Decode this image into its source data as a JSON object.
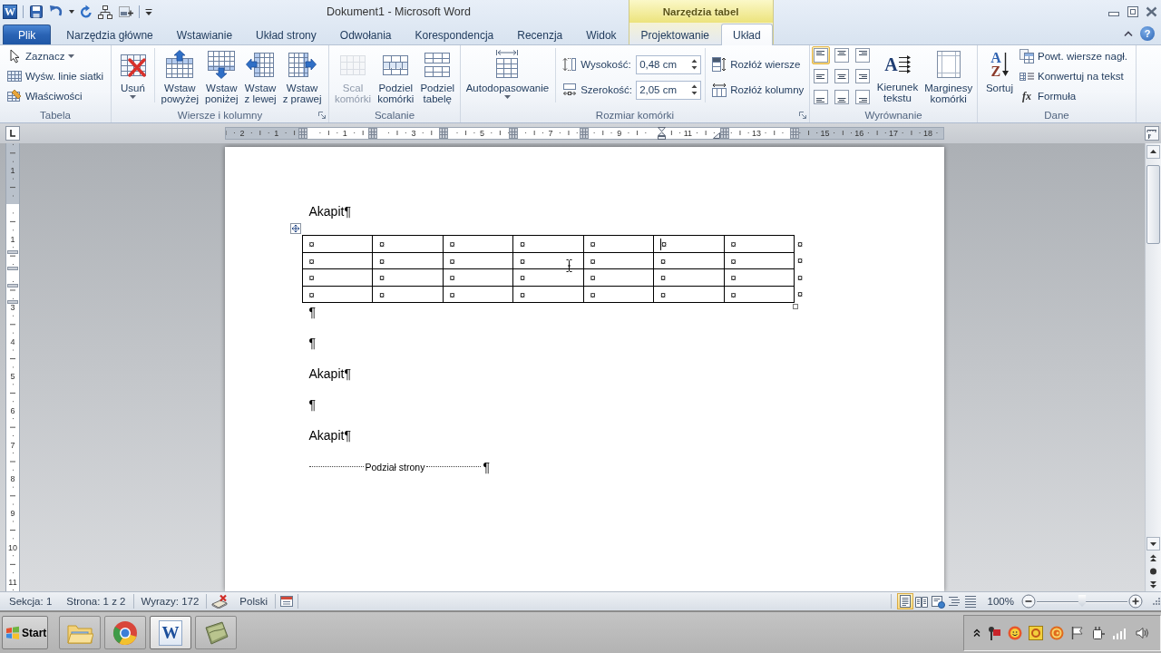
{
  "title_bar": {
    "app_icon_glyph": "W",
    "title": "Dokument1 - Microsoft Word",
    "context_header": "Narzędzia tabel",
    "help_glyph": "?"
  },
  "tabs": [
    {
      "label": "Plik",
      "kind": "file",
      "selected": false
    },
    {
      "label": "Narzędzia główne",
      "kind": "normal",
      "selected": false
    },
    {
      "label": "Wstawianie",
      "kind": "normal",
      "selected": false
    },
    {
      "label": "Układ strony",
      "kind": "normal",
      "selected": false
    },
    {
      "label": "Odwołania",
      "kind": "normal",
      "selected": false
    },
    {
      "label": "Korespondencja",
      "kind": "normal",
      "selected": false
    },
    {
      "label": "Recenzja",
      "kind": "normal",
      "selected": false
    },
    {
      "label": "Widok",
      "kind": "normal",
      "selected": false
    },
    {
      "label": "Projektowanie",
      "kind": "contextual",
      "selected": false
    },
    {
      "label": "Układ",
      "kind": "contextual",
      "selected": true
    }
  ],
  "ribbon": {
    "groups": [
      {
        "label": "Tabela",
        "launcher": false,
        "sections": [
          [
            {
              "kind": "stack",
              "items": [
                {
                  "label": "Zaznacz",
                  "dropdown": true,
                  "disabled": false
                },
                {
                  "label": "Wyśw. linie siatki",
                  "dropdown": false,
                  "disabled": false
                },
                {
                  "label": "Właściwości",
                  "dropdown": false,
                  "disabled": false
                }
              ]
            }
          ]
        ]
      },
      {
        "label": "Wiersze i kolumny",
        "launcher": true,
        "sections": [
          [
            {
              "kind": "large",
              "lines": [
                "Usuń"
              ],
              "dropdown": true,
              "disabled": false
            }
          ],
          [
            {
              "kind": "large",
              "lines": [
                "Wstaw",
                "powyżej"
              ],
              "dropdown": false,
              "disabled": false
            },
            {
              "kind": "large",
              "lines": [
                "Wstaw",
                "poniżej"
              ],
              "dropdown": false,
              "disabled": false
            },
            {
              "kind": "large",
              "lines": [
                "Wstaw",
                "z lewej"
              ],
              "dropdown": false,
              "disabled": false
            },
            {
              "kind": "large",
              "lines": [
                "Wstaw",
                "z prawej"
              ],
              "dropdown": false,
              "disabled": false
            }
          ]
        ]
      },
      {
        "label": "Scalanie",
        "launcher": false,
        "sections": [
          [
            {
              "kind": "large",
              "lines": [
                "Scal",
                "komórki"
              ],
              "dropdown": false,
              "disabled": true
            },
            {
              "kind": "large",
              "lines": [
                "Podziel",
                "komórki"
              ],
              "dropdown": false,
              "disabled": false
            },
            {
              "kind": "large",
              "lines": [
                "Podziel",
                "tabelę"
              ],
              "dropdown": false,
              "disabled": false
            }
          ]
        ]
      },
      {
        "label": "Rozmiar komórki",
        "launcher": true,
        "sections": [
          [
            {
              "kind": "large",
              "lines": [
                "Autodopasowanie"
              ],
              "dropdown": true,
              "disabled": false
            }
          ],
          [
            {
              "kind": "spins",
              "items": [
                {
                  "label": "Wysokość:",
                  "value": "0,48 cm"
                },
                {
                  "label": "Szerokość:",
                  "value": "2,05 cm"
                }
              ]
            }
          ],
          [
            {
              "kind": "stack",
              "items": [
                {
                  "label": "Rozłóż wiersze",
                  "dropdown": false,
                  "disabled": false
                },
                {
                  "label": "Rozłóż kolumny",
                  "dropdown": false,
                  "disabled": false
                }
              ]
            }
          ]
        ]
      },
      {
        "label": "Wyrównanie",
        "launcher": false,
        "sections": [
          [
            {
              "kind": "align_grid",
              "buttons": [
                {
                  "selected": true
                },
                {
                  "selected": false
                },
                {
                  "selected": false
                },
                {
                  "selected": false
                },
                {
                  "selected": false
                },
                {
                  "selected": false
                },
                {
                  "selected": false
                },
                {
                  "selected": false
                },
                {
                  "selected": false
                }
              ]
            },
            {
              "kind": "large",
              "lines": [
                "Kierunek",
                "tekstu"
              ],
              "glyphs": [
                "A"
              ],
              "dropdown": false,
              "disabled": false
            },
            {
              "kind": "large",
              "lines": [
                "Marginesy",
                "komórki"
              ],
              "dropdown": false,
              "disabled": false
            }
          ]
        ]
      },
      {
        "label": "Dane",
        "launcher": false,
        "sections": [
          [
            {
              "kind": "large",
              "lines": [
                "Sortuj"
              ],
              "glyphs": [
                "A",
                "Z"
              ],
              "dropdown": false,
              "disabled": false
            },
            {
              "kind": "stack",
              "items": [
                {
                  "label": "Powt. wiersze nagł.",
                  "dropdown": false,
                  "disabled": false
                },
                {
                  "label": "Konwertuj na tekst",
                  "dropdown": false,
                  "disabled": false
                },
                {
                  "label": "Formuła",
                  "glyph": "fx",
                  "dropdown": false,
                  "disabled": false
                }
              ]
            }
          ]
        ]
      }
    ]
  },
  "rulers": {
    "horizontal": [
      "2",
      "1",
      "1",
      "3",
      "5",
      "7",
      "9",
      "11",
      "13",
      "15",
      "16",
      "17",
      "18"
    ],
    "vertical": [
      "1",
      "1",
      "3",
      "4",
      "5",
      "6",
      "7",
      "8",
      "9",
      "10",
      "11"
    ]
  },
  "document": {
    "blocks": [
      {
        "kind": "paragraph",
        "text": "Akapit¶"
      },
      {
        "kind": "table",
        "rows": [
          {
            "cells": [
              {
                "text": "¤",
                "caret": false
              },
              {
                "text": "¤",
                "caret": false
              },
              {
                "text": "¤",
                "caret": false
              },
              {
                "text": "¤",
                "caret": false
              },
              {
                "text": "¤",
                "caret": false
              },
              {
                "text": "¤",
                "caret": true
              },
              {
                "text": "¤",
                "caret": false
              }
            ],
            "end_mark": "¤"
          },
          {
            "cells": [
              {
                "text": "¤",
                "caret": false
              },
              {
                "text": "¤",
                "caret": false
              },
              {
                "text": "¤",
                "caret": false
              },
              {
                "text": "¤",
                "caret": false
              },
              {
                "text": "¤",
                "caret": false
              },
              {
                "text": "¤",
                "caret": false
              },
              {
                "text": "¤",
                "caret": false
              }
            ],
            "end_mark": "¤"
          },
          {
            "cells": [
              {
                "text": "¤",
                "caret": false
              },
              {
                "text": "¤",
                "caret": false
              },
              {
                "text": "¤",
                "caret": false
              },
              {
                "text": "¤",
                "caret": false
              },
              {
                "text": "¤",
                "caret": false
              },
              {
                "text": "¤",
                "caret": false
              },
              {
                "text": "¤",
                "caret": false
              }
            ],
            "end_mark": "¤"
          },
          {
            "cells": [
              {
                "text": "¤",
                "caret": false
              },
              {
                "text": "¤",
                "caret": false
              },
              {
                "text": "¤",
                "caret": false
              },
              {
                "text": "¤",
                "caret": false
              },
              {
                "text": "¤",
                "caret": false
              },
              {
                "text": "¤",
                "caret": false
              },
              {
                "text": "¤",
                "caret": false
              }
            ],
            "end_mark": "¤"
          }
        ]
      },
      {
        "kind": "paragraph",
        "text": "¶"
      },
      {
        "kind": "paragraph",
        "text": "¶"
      },
      {
        "kind": "paragraph",
        "text": "Akapit¶"
      },
      {
        "kind": "paragraph",
        "text": "¶"
      },
      {
        "kind": "paragraph",
        "text": "Akapit¶"
      },
      {
        "kind": "page_break",
        "label": "Podział strony",
        "mark": "¶"
      }
    ]
  },
  "status_bar": {
    "section": "Sekcja: 1",
    "page": "Strona: 1 z 2",
    "words": "Wyrazy: 172",
    "language": "Polski",
    "view_buttons": [
      {
        "selected": true
      },
      {
        "selected": false
      },
      {
        "selected": false
      },
      {
        "selected": false
      },
      {
        "selected": false
      }
    ],
    "zoom": {
      "label": "100%",
      "level": 0.5
    }
  },
  "taskbar": {
    "start": "Start",
    "buttons": [
      {
        "selected": false
      },
      {
        "selected": false
      },
      {
        "selected": true,
        "glyph": "W"
      },
      {
        "selected": false
      }
    ]
  }
}
